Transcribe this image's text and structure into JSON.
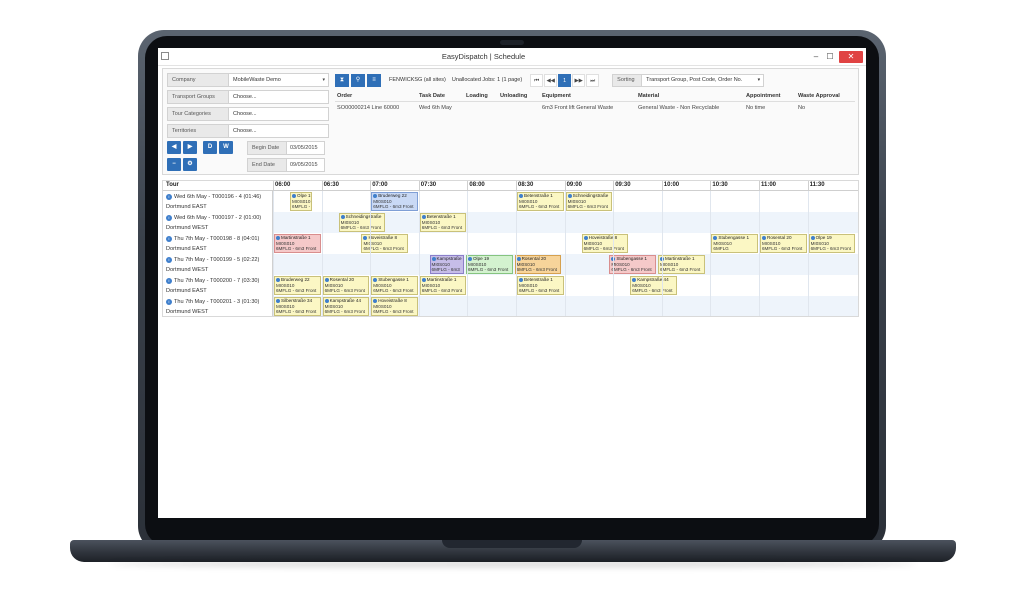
{
  "window": {
    "title": "EasyDispatch | Schedule",
    "minimize": "–",
    "maximize": "☐",
    "close": "✕"
  },
  "filters": {
    "company": {
      "label": "Company",
      "value": "MobileWaste Demo"
    },
    "transport_groups": {
      "label": "Transport Groups",
      "value": "Choose..."
    },
    "tour_categories": {
      "label": "Tour Categories",
      "value": "Choose..."
    },
    "territories": {
      "label": "Territories",
      "value": "Choose..."
    },
    "begin_date": {
      "label": "Begin Date",
      "value": "03/05/2015"
    },
    "end_date": {
      "label": "End Date",
      "value": "09/05/2015"
    },
    "buttons": {
      "prev": "◀",
      "next": "▶",
      "day": "D",
      "week": "W",
      "minus": "−",
      "gear": "⚙"
    }
  },
  "toolbar": {
    "icons": [
      "filter-icon",
      "pin-icon",
      "list-icon"
    ],
    "site": "FENWICKSG (all sites)",
    "unallocated": "Unallocated Jobs: 1 (1 page)",
    "pager": [
      "⏮",
      "◀◀",
      "1",
      "▶▶",
      "⏭"
    ],
    "sorting_label": "Sorting",
    "sorting_value": "Transport Group, Post Code, Order No."
  },
  "jobs_table": {
    "headers": [
      "Order",
      "Task Date",
      "Loading",
      "Unloading",
      "Equipment",
      "Material",
      "Appointment",
      "Waste Approval"
    ],
    "rows": [
      [
        "SO00000214 Line 60000",
        "Wed 6th May",
        "",
        "",
        "6m3 Front lift General Waste",
        "General Waste - Non Recyclable",
        "No time",
        "No"
      ]
    ]
  },
  "schedule": {
    "tour_header": "Tour",
    "times": [
      "06:00",
      "06:30",
      "07:00",
      "07:30",
      "08:00",
      "08:30",
      "09:00",
      "09:30",
      "10:00",
      "10:30",
      "11:00",
      "11:30"
    ],
    "tours": [
      {
        "name": "Wed 6th May - T000196 - 4 (01:46)",
        "territory": "Dortmund EAST"
      },
      {
        "name": "Wed 6th May - T000197 - 2 (01:00)",
        "territory": "Dortmund WEST"
      },
      {
        "name": "Thu 7th May - T000198 - 8 (04:01)",
        "territory": "Dortmund EAST"
      },
      {
        "name": "Thu 7th May - T000199 - 5 (02:22)",
        "territory": "Dortmund WEST"
      },
      {
        "name": "Thu 7th May - T000200 - 7 (03:30)",
        "territory": "Dortmund EAST"
      },
      {
        "name": "Thu 7th May - T000201 - 3 (01:30)",
        "territory": "Dortmund WEST"
      }
    ],
    "jobs": [
      {
        "row": 0,
        "start": 0.33,
        "span": 0.5,
        "color": "yellow",
        "title": "Olpe 19",
        "code": "MI0S010",
        "eq": "6MFLG - 6"
      },
      {
        "row": 0,
        "start": 2.0,
        "span": 1.0,
        "color": "blue",
        "title": "Bruderweg 22",
        "code": "MI0S010",
        "eq": "6MFLG - 6m3 Front"
      },
      {
        "row": 0,
        "start": 5.0,
        "span": 1.0,
        "color": "yellow",
        "title": "Betenstraße 1",
        "code": "MI0S010",
        "eq": "6MFLG - 6m3 Front"
      },
      {
        "row": 0,
        "start": 6.0,
        "span": 1.0,
        "color": "yellow",
        "title": "Schneidingstraße",
        "code": "MI0S010",
        "eq": "6MFLG - 6m3 Front"
      },
      {
        "row": 1,
        "start": 1.33,
        "span": 1.0,
        "color": "yellow",
        "title": "Schneidingstraße",
        "code": "MI0S010",
        "eq": "6MFLG - 6m3 Front"
      },
      {
        "row": 1,
        "start": 3.0,
        "span": 1.0,
        "color": "yellow",
        "title": "Betenstraße 1",
        "code": "MI0S010",
        "eq": "6MFLG - 6m3 Front"
      },
      {
        "row": 2,
        "start": 0.0,
        "span": 1.0,
        "color": "pink",
        "title": "Martinstraße 1",
        "code": "MI0S010",
        "eq": "6MFLG - 6m3 Front"
      },
      {
        "row": 2,
        "start": 1.8,
        "span": 1.0,
        "color": "yellow",
        "title": "Hoveistraße 8",
        "code": "MI0S010",
        "eq": "6MFLG - 6m3 Front"
      },
      {
        "row": 2,
        "start": 6.33,
        "span": 1.0,
        "color": "yellow",
        "title": "Hoveistraße 8",
        "code": "MI0S010",
        "eq": "6MFLG - 6m3 Front"
      },
      {
        "row": 2,
        "start": 9.0,
        "span": 1.0,
        "color": "yellow",
        "title": "Stubengasse 1",
        "code": "MI0S010",
        "eq": "6MFLG"
      },
      {
        "row": 2,
        "start": 10.0,
        "span": 1.0,
        "color": "yellow",
        "title": "Rosental 20",
        "code": "MI0S010",
        "eq": "6MFLG - 6m3 Front"
      },
      {
        "row": 2,
        "start": 11.0,
        "span": 1.0,
        "color": "yellow",
        "title": "Olpe 19",
        "code": "MI0S010",
        "eq": "6MFLG - 6m3 Front"
      },
      {
        "row": 3,
        "start": 3.2,
        "span": 0.75,
        "color": "purple",
        "title": "Kampstraße",
        "code": "MI0S010",
        "eq": "6MFLG - 6m3"
      },
      {
        "row": 3,
        "start": 3.95,
        "span": 1.0,
        "color": "green",
        "title": "Olpe 19",
        "code": "MI0S010",
        "eq": "6MFLG - 6m3 Front"
      },
      {
        "row": 3,
        "start": 4.95,
        "span": 1.0,
        "color": "orange",
        "title": "Rosental 20",
        "code": "MI0S010",
        "eq": "6MFLG - 6m3 Front"
      },
      {
        "row": 3,
        "start": 6.9,
        "span": 1.0,
        "color": "pink",
        "title": "Stubengasse 1",
        "code": "MI0S010",
        "eq": "6MFLG - 6m3 Front"
      },
      {
        "row": 3,
        "start": 7.9,
        "span": 1.0,
        "color": "yellow",
        "title": "Martinstraße 1",
        "code": "MI0S010",
        "eq": "6MFLG - 6m3 Front"
      },
      {
        "row": 4,
        "start": 0.0,
        "span": 1.0,
        "color": "yellow",
        "title": "Bruderweg 22",
        "code": "MI0S010",
        "eq": "6MFLG - 6m3 Front"
      },
      {
        "row": 4,
        "start": 1.0,
        "span": 1.0,
        "color": "yellow",
        "title": "Rosental 20",
        "code": "MI0S010",
        "eq": "6MFLG - 6m3 Front"
      },
      {
        "row": 4,
        "start": 2.0,
        "span": 1.0,
        "color": "yellow",
        "title": "Stubengasse 1",
        "code": "MI0S010",
        "eq": "6MFLG - 6m3 Front"
      },
      {
        "row": 4,
        "start": 3.0,
        "span": 1.0,
        "color": "yellow",
        "title": "Martinstraße 1",
        "code": "MI0S010",
        "eq": "6MFLG - 6m3 Front"
      },
      {
        "row": 4,
        "start": 5.0,
        "span": 1.0,
        "color": "yellow",
        "title": "Betenstraße 1",
        "code": "MI0S010",
        "eq": "6MFLG - 6m3 Front"
      },
      {
        "row": 4,
        "start": 7.33,
        "span": 1.0,
        "color": "yellow",
        "title": "Kampstraße 44",
        "code": "MI0S010",
        "eq": "6MFLG - 6m3 Front"
      },
      {
        "row": 5,
        "start": 0.0,
        "span": 1.0,
        "color": "yellow",
        "title": "Silberstraße 34",
        "code": "MI0S010",
        "eq": "6MFLG - 6m3 Front"
      },
      {
        "row": 5,
        "start": 1.0,
        "span": 1.0,
        "color": "yellow",
        "title": "Kampstraße 44",
        "code": "MI0S010",
        "eq": "6MFLG - 6m3 Front"
      },
      {
        "row": 5,
        "start": 2.0,
        "span": 1.0,
        "color": "yellow",
        "title": "Hoveistraße 8",
        "code": "MI0S010",
        "eq": "6MFLG - 6m3 Front"
      }
    ]
  }
}
